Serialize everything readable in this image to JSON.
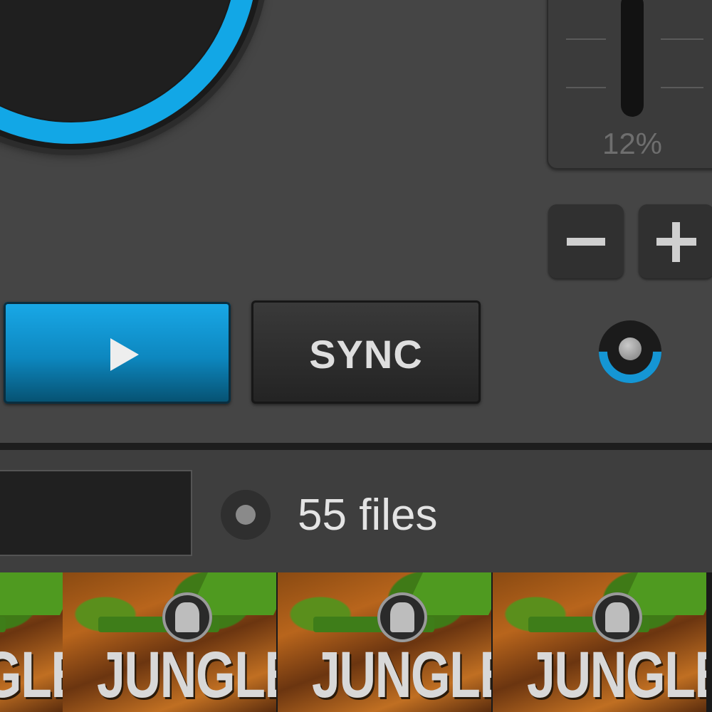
{
  "deck": {
    "pitch": {
      "value_label": "12%",
      "minus_label": "−",
      "plus_label": "+"
    },
    "transport": {
      "play_icon": "play-icon",
      "sync_label": "SYNC"
    },
    "colors": {
      "accent": "#12a7e6",
      "panel": "#454545",
      "button_dark": "#2a2a2a"
    }
  },
  "browser": {
    "search_value": "",
    "status_icon": "status-dot-icon",
    "file_count": "55 files"
  },
  "albums": [
    {
      "title": "JUNGLE"
    },
    {
      "title": "JUNGLE"
    },
    {
      "title": "JUNGLE"
    },
    {
      "title": "JUNGLE"
    }
  ]
}
